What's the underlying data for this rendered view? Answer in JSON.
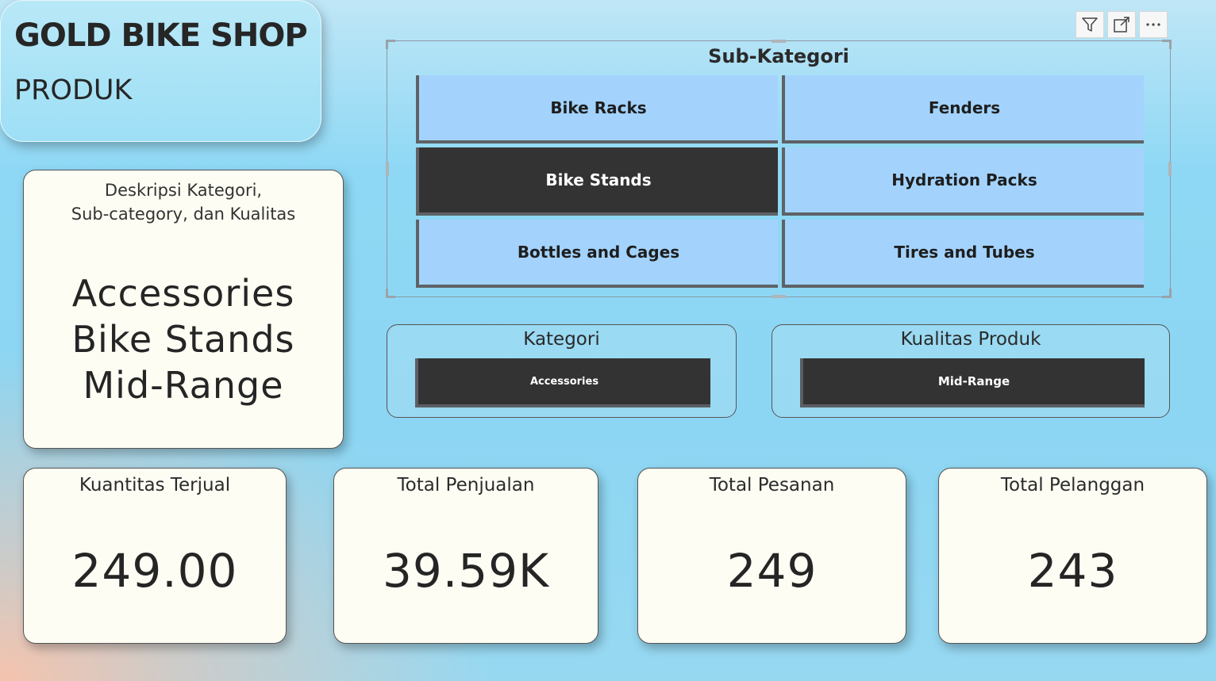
{
  "header": {
    "title": "GOLD BIKE SHOP",
    "subtitle": "PRODUK"
  },
  "description": {
    "heading_line1": "Deskripsi Kategori,",
    "heading_line2": "Sub-category, dan Kualitas",
    "category": "Accessories",
    "subcategory": "Bike Stands",
    "quality": "Mid-Range"
  },
  "subcategory_slicer": {
    "title": "Sub-Kategori",
    "items": [
      {
        "label": "Bike Racks",
        "selected": false
      },
      {
        "label": "Fenders",
        "selected": false
      },
      {
        "label": "Bike Stands",
        "selected": true
      },
      {
        "label": "Hydration Packs",
        "selected": false
      },
      {
        "label": "Bottles and Cages",
        "selected": false
      },
      {
        "label": "Tires and Tubes",
        "selected": false
      }
    ]
  },
  "toolbar": {
    "icons": [
      "filter-icon",
      "focus-mode-icon",
      "more-options-icon"
    ]
  },
  "kategori_slicer": {
    "title": "Kategori",
    "selected": "Accessories"
  },
  "kualitas_slicer": {
    "title": "Kualitas Produk",
    "selected": "Mid-Range"
  },
  "kpis": {
    "quantity": {
      "label": "Kuantitas Terjual",
      "value": "249.00"
    },
    "sales": {
      "label": "Total Penjualan",
      "value": "39.59K"
    },
    "orders": {
      "label": "Total Pesanan",
      "value": "249"
    },
    "customers": {
      "label": "Total Pelanggan",
      "value": "243"
    }
  },
  "colors": {
    "selected_tile": "#333333",
    "tile": "#a3d3fd",
    "card_bg": "#fdfdf3"
  }
}
